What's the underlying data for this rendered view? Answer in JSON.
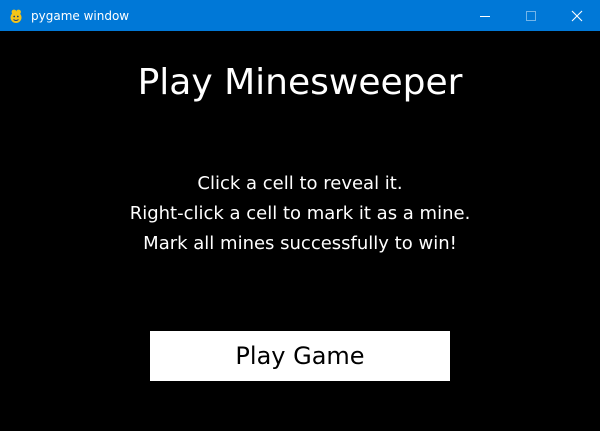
{
  "window": {
    "title": "pygame window",
    "titlebar_color": "#0078d7",
    "icon": "pygame-snake-icon",
    "controls": [
      "minimize-icon",
      "maximize-icon",
      "close-icon"
    ]
  },
  "screen": {
    "background": "#000000",
    "heading": "Play Minesweeper",
    "instructions": [
      "Click a cell to reveal it.",
      "Right-click a cell to mark it as a mine.",
      "Mark all mines successfully to win!"
    ],
    "play_button_label": "Play Game"
  }
}
